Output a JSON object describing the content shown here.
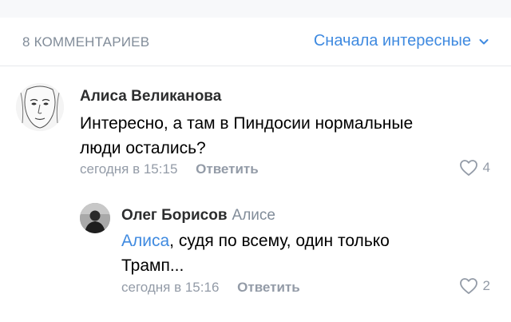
{
  "header": {
    "count": "8 КОММЕНТАРИЕВ",
    "sort_label": "Сначала интересные"
  },
  "comments": [
    {
      "author": "Алиса Великанова",
      "text_line1": "Интересно, а там в Пиндосии нормальные",
      "text_line2": "люди остались?",
      "time": "сегодня в 15:15",
      "reply_label": "Ответить",
      "likes": "4"
    },
    {
      "author": "Олег Борисов",
      "reply_to": "Алисе",
      "mention": "Алиса",
      "text_line1": ", судя по всему, один только",
      "text_line2": "Трамп...",
      "time": "сегодня в 15:16",
      "reply_label": "Ответить",
      "likes": "2"
    }
  ],
  "colors": {
    "accent": "#3f8ae0",
    "secondary": "#818c99",
    "meta": "#939ba7"
  }
}
